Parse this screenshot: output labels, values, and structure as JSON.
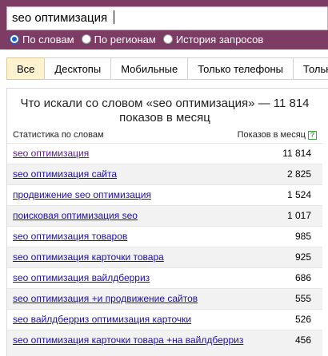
{
  "search": {
    "query": "seo оптимизация"
  },
  "modes": [
    {
      "label": "По словам",
      "selected": true
    },
    {
      "label": "По регионам",
      "selected": false
    },
    {
      "label": "История запросов",
      "selected": false
    }
  ],
  "tabs": [
    {
      "label": "Все",
      "active": true
    },
    {
      "label": "Десктопы",
      "active": false
    },
    {
      "label": "Мобильные",
      "active": false
    },
    {
      "label": "Только телефоны",
      "active": false
    },
    {
      "label": "Тольк",
      "active": false
    }
  ],
  "panel": {
    "title": "Что искали со словом «seo оптимизация» — 11 814 показов в месяц",
    "col_left": "Статистика по словам",
    "col_right": "Показов в месяц",
    "help_glyph": "?",
    "rows": [
      {
        "phrase": "seo оптимизация",
        "count": "11 814"
      },
      {
        "phrase": "seo оптимизация сайта",
        "count": "2 825"
      },
      {
        "phrase": "продвижение seo оптимизация",
        "count": "1 524"
      },
      {
        "phrase": "поисковая оптимизация seo",
        "count": "1 017"
      },
      {
        "phrase": "seo оптимизация товаров",
        "count": "985"
      },
      {
        "phrase": "seo оптимизация карточки товара",
        "count": "925"
      },
      {
        "phrase": "seo оптимизация вайлдберриз",
        "count": "686"
      },
      {
        "phrase": "seo оптимизация +и продвижение сайтов",
        "count": "555"
      },
      {
        "phrase": "seo вайлдберриз оптимизация карточки",
        "count": "526"
      },
      {
        "phrase": "seo оптимизация карточки товара +на вайлдберриз",
        "count": "456"
      }
    ]
  },
  "colors": {
    "topbar": "#7c3c64",
    "link": "#1a0dab",
    "visited": "#551a8b",
    "active_tab": "#fff3cf",
    "help": "#43a047"
  }
}
